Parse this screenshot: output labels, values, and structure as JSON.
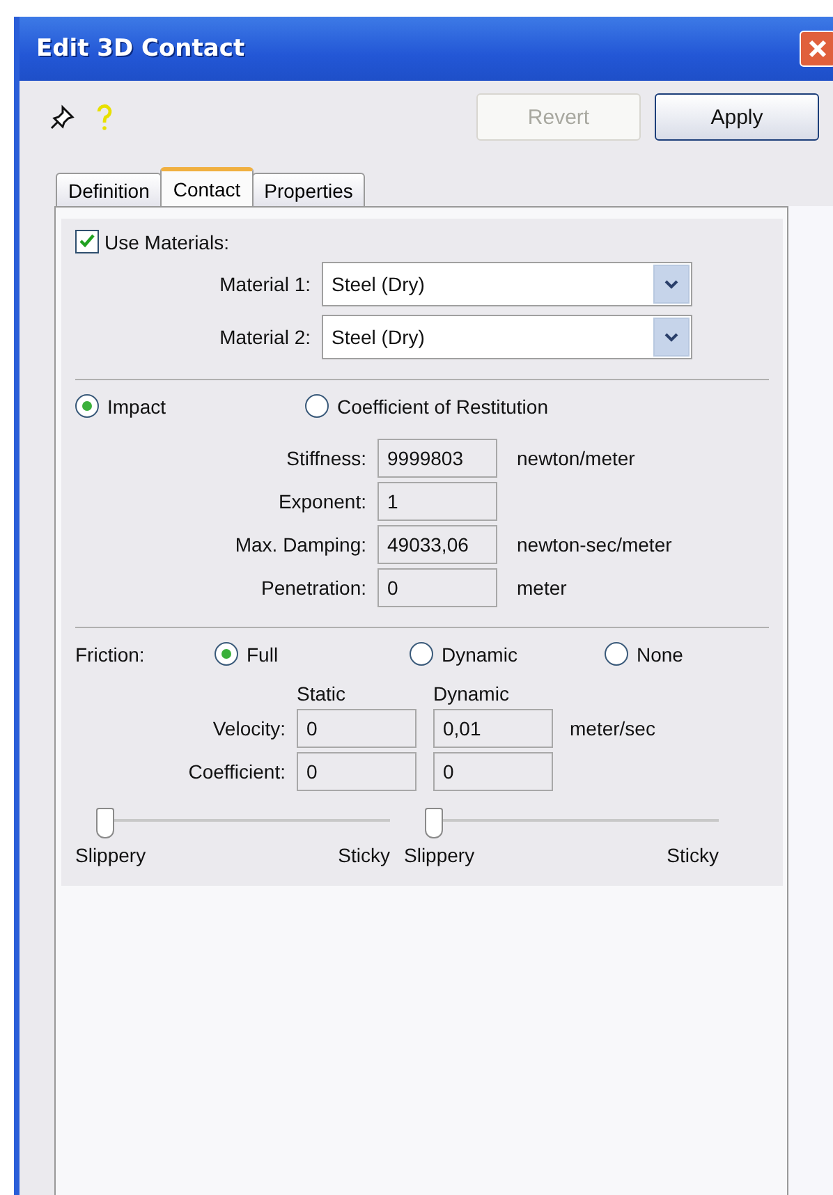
{
  "window": {
    "title": "Edit 3D Contact"
  },
  "toolbar": {
    "buttons": [
      {
        "label": "Revert",
        "disabled": true
      },
      {
        "label": "Apply",
        "disabled": false
      }
    ]
  },
  "tabs": [
    {
      "label": "Definition",
      "selected": false
    },
    {
      "label": "Contact",
      "selected": true
    },
    {
      "label": "Properties",
      "selected": false
    }
  ],
  "use_materials": {
    "label": "Use Materials:",
    "checked": true
  },
  "materials": [
    {
      "label": "Material 1:",
      "value": "Steel (Dry)"
    },
    {
      "label": "Material 2:",
      "value": "Steel (Dry)"
    }
  ],
  "contact_model": [
    {
      "label": "Impact",
      "selected": true
    },
    {
      "label": "Coefficient of Restitution",
      "selected": false
    }
  ],
  "impact_fields": [
    {
      "label": "Stiffness:",
      "value": "9999803",
      "unit": "newton/meter"
    },
    {
      "label": "Exponent:",
      "value": "1"
    },
    {
      "label": "Max. Damping:",
      "value": "49033,06",
      "unit": "newton-sec/meter"
    },
    {
      "label": "Penetration:",
      "value": "0",
      "unit": "meter"
    }
  ],
  "friction": {
    "label": "Friction:",
    "options": [
      {
        "label": "Full",
        "selected": true
      },
      {
        "label": "Dynamic",
        "selected": false
      },
      {
        "label": "None",
        "selected": false
      }
    ],
    "columns": [
      "Static",
      "Dynamic"
    ],
    "rows": [
      {
        "label": "Velocity:",
        "values": [
          "0",
          "0,01"
        ],
        "unit": "meter/sec"
      },
      {
        "label": "Coefficient:",
        "values": [
          "0",
          "0"
        ]
      }
    ],
    "sliders": [
      {
        "level": 0,
        "min_label": "Slippery",
        "max_label": "Sticky"
      },
      {
        "level": 0,
        "min_label": "Slippery",
        "max_label": "Sticky"
      }
    ]
  }
}
